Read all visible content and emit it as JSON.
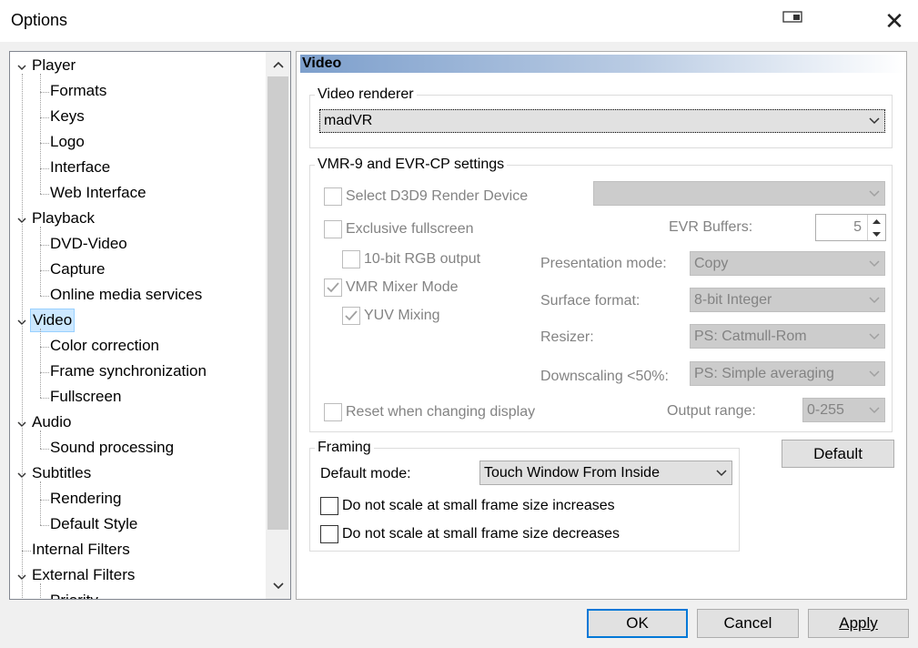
{
  "window": {
    "title": "Options",
    "close_glyph": "✕"
  },
  "tree": {
    "items": [
      {
        "label": "Player",
        "level": 0,
        "expanded": true
      },
      {
        "label": "Formats",
        "level": 1
      },
      {
        "label": "Keys",
        "level": 1
      },
      {
        "label": "Logo",
        "level": 1
      },
      {
        "label": "Interface",
        "level": 1
      },
      {
        "label": "Web Interface",
        "level": 1
      },
      {
        "label": "Playback",
        "level": 0,
        "expanded": true
      },
      {
        "label": "DVD-Video",
        "level": 1
      },
      {
        "label": "Capture",
        "level": 1
      },
      {
        "label": "Online media services",
        "level": 1
      },
      {
        "label": "Video",
        "level": 0,
        "expanded": true,
        "selected": true
      },
      {
        "label": "Color correction",
        "level": 1
      },
      {
        "label": "Frame synchronization",
        "level": 1
      },
      {
        "label": "Fullscreen",
        "level": 1
      },
      {
        "label": "Audio",
        "level": 0,
        "expanded": true
      },
      {
        "label": "Sound processing",
        "level": 1
      },
      {
        "label": "Subtitles",
        "level": 0,
        "expanded": true
      },
      {
        "label": "Rendering",
        "level": 1
      },
      {
        "label": "Default Style",
        "level": 1
      },
      {
        "label": "Internal Filters",
        "level": 0
      },
      {
        "label": "External Filters",
        "level": 0,
        "expanded": true
      },
      {
        "label": "Priority",
        "level": 1
      }
    ]
  },
  "panel": {
    "section_title": "Video",
    "video_renderer": {
      "group_label": "Video renderer",
      "value": "madVR"
    },
    "vmr": {
      "group_label": "VMR-9 and EVR-CP settings",
      "select_d3d9": "Select D3D9 Render Device",
      "exclusive_fullscreen": "Exclusive fullscreen",
      "rgb10": "10-bit RGB output",
      "vmr_mixer": "VMR Mixer Mode",
      "yuv_mixing": "YUV Mixing",
      "reset_display": "Reset when changing display",
      "evr_buffers_label": "EVR Buffers:",
      "evr_buffers_value": "5",
      "presentation_label": "Presentation mode:",
      "presentation_value": "Copy",
      "surface_label": "Surface format:",
      "surface_value": "8-bit Integer",
      "resizer_label": "Resizer:",
      "resizer_value": "PS: Catmull-Rom",
      "downscaling_label": "Downscaling <50%:",
      "downscaling_value": "PS: Simple averaging",
      "output_range_label": "Output range:",
      "output_range_value": "0-255"
    },
    "framing": {
      "group_label": "Framing",
      "default_mode_label": "Default mode:",
      "default_mode_value": "Touch Window From Inside",
      "no_scale_inc": "Do not scale at small frame size increases",
      "no_scale_dec": "Do not scale at small frame size decreases"
    },
    "default_button": "Default"
  },
  "buttons": {
    "ok": "OK",
    "cancel": "Cancel",
    "apply": "Apply"
  }
}
